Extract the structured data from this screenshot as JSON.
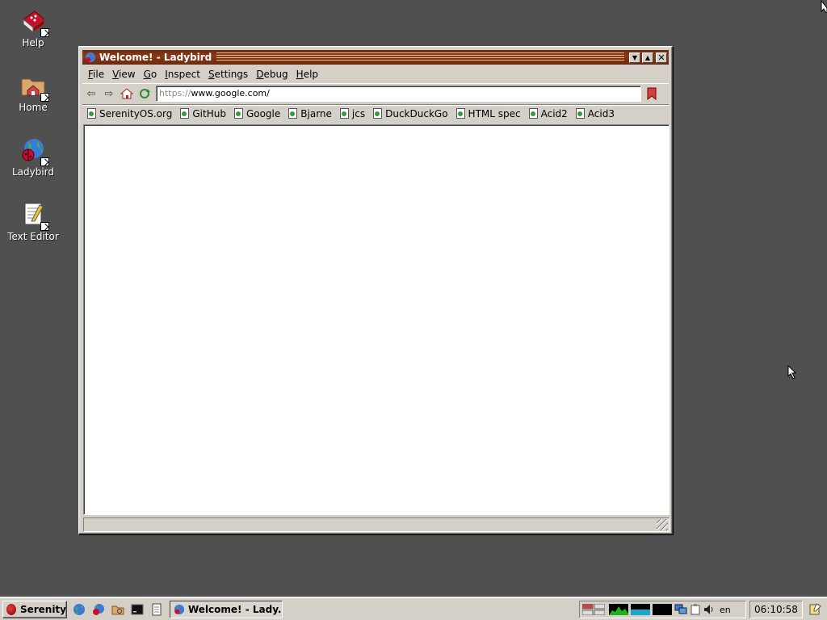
{
  "desktop": {
    "icons": [
      {
        "label": "Help",
        "icon": "help-book-icon"
      },
      {
        "label": "Home",
        "icon": "home-folder-icon"
      },
      {
        "label": "Ladybird",
        "icon": "ladybird-icon"
      },
      {
        "label": "Text Editor",
        "icon": "text-editor-icon"
      }
    ]
  },
  "window": {
    "title": "Welcome! - Ladybird",
    "menus": [
      "File",
      "View",
      "Go",
      "Inspect",
      "Settings",
      "Debug",
      "Help"
    ],
    "url": {
      "scheme": "https://",
      "rest": "www.google.com/"
    },
    "bookmarks": [
      "SerenityOS.org",
      "GitHub",
      "Google",
      "Bjarne",
      "jcs",
      "DuckDuckGo",
      "HTML spec",
      "Acid2",
      "Acid3"
    ]
  },
  "taskbar": {
    "start_label": "Serenity",
    "task_label": "Welcome! - Lady...",
    "keyboard_layout": "en",
    "clock": "06:10:58"
  },
  "colors": {
    "desktop": "#505050",
    "titlebar": "#7a3214",
    "chrome": "#d4d0c8"
  }
}
